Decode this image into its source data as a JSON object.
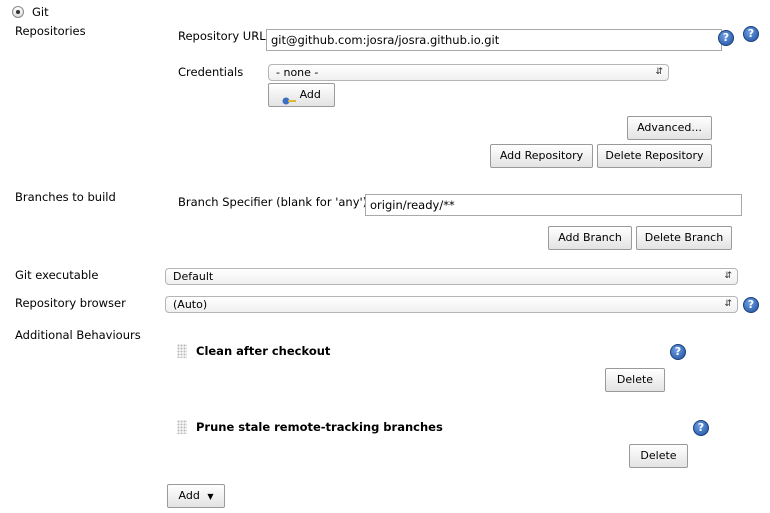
{
  "scm": {
    "label": "Git",
    "selected": true
  },
  "repositories": {
    "section_label": "Repositories",
    "url_label": "Repository URL",
    "url_value": "git@github.com:josra/josra.github.io.git",
    "credentials_label": "Credentials",
    "credentials_value": "- none -",
    "add_credentials_label": "Add",
    "advanced_label": "Advanced...",
    "add_repository_label": "Add Repository",
    "delete_repository_label": "Delete Repository"
  },
  "branches": {
    "section_label": "Branches to build",
    "specifier_label": "Branch Specifier (blank for 'any')",
    "specifier_value": "origin/ready/**",
    "add_branch_label": "Add Branch",
    "delete_branch_label": "Delete Branch"
  },
  "git_executable": {
    "label": "Git executable",
    "value": "Default"
  },
  "repository_browser": {
    "label": "Repository browser",
    "value": "(Auto)"
  },
  "behaviours": {
    "section_label": "Additional Behaviours",
    "items": [
      {
        "title": "Clean after checkout",
        "delete_label": "Delete"
      },
      {
        "title": "Prune stale remote-tracking branches",
        "delete_label": "Delete"
      }
    ],
    "add_label": "Add"
  },
  "help_glyph": "?",
  "colors": {
    "help_icon": "#1d4f9c",
    "button_border": "#9a9a9a"
  }
}
